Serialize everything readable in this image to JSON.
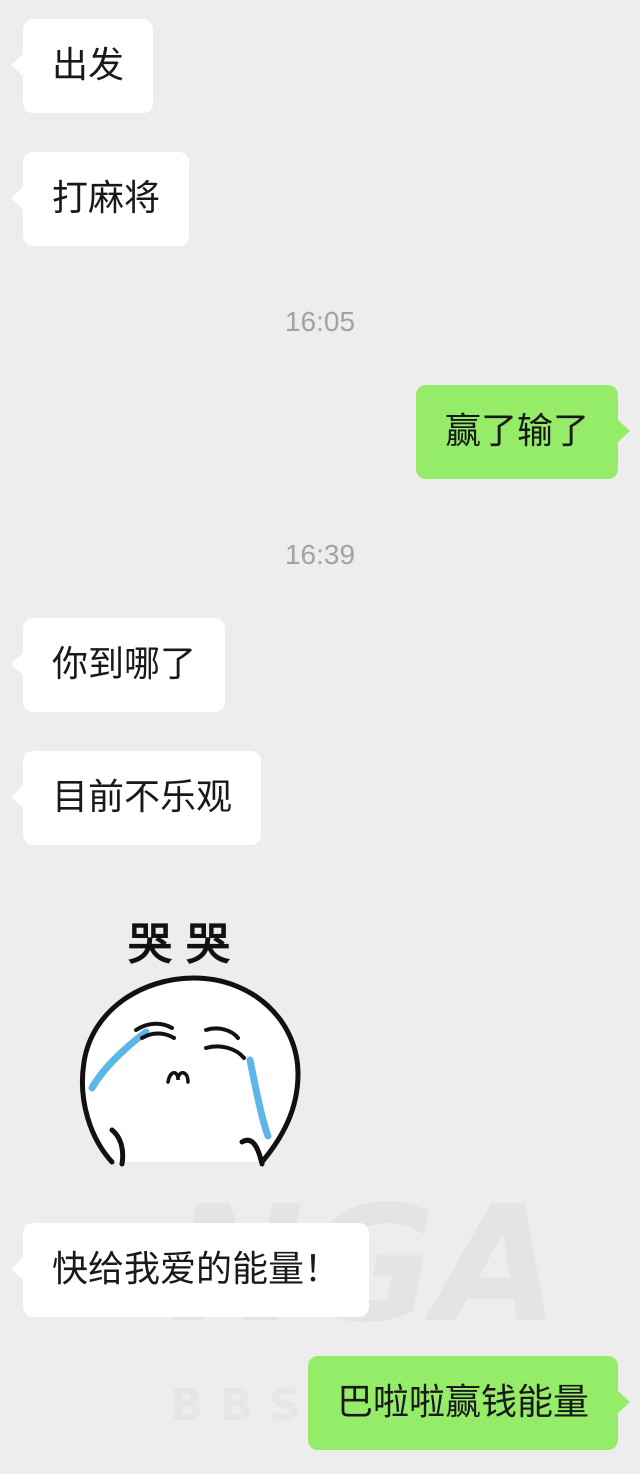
{
  "watermark": {
    "logo": "NGA",
    "text": "BBS.NGA.CN"
  },
  "messages": [
    {
      "side": "in",
      "text": "出发"
    },
    {
      "side": "in",
      "text": "打麻将"
    },
    {
      "type": "time",
      "text": "16:05"
    },
    {
      "side": "out",
      "text": "赢了输了"
    },
    {
      "type": "time",
      "text": "16:39"
    },
    {
      "side": "in",
      "text": "你到哪了"
    },
    {
      "side": "in",
      "text": "目前不乐观"
    },
    {
      "side": "in",
      "type": "sticker",
      "caption": "哭哭",
      "icon": "crying-face-sticker"
    },
    {
      "side": "in",
      "text": "快给我爱的能量！"
    },
    {
      "side": "out",
      "text": "巴啦啦赢钱能量"
    }
  ]
}
